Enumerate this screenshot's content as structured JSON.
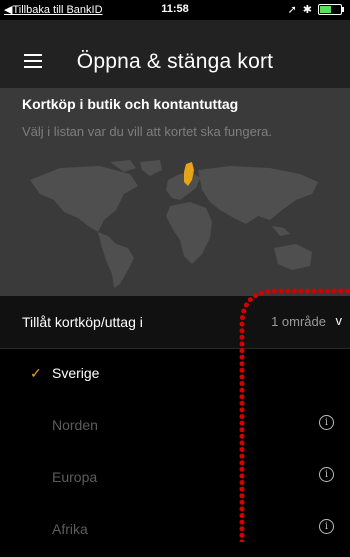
{
  "status_bar": {
    "back_label": "◀Tillbaka till BankID",
    "time": "11:58",
    "battery_color": "#5be05b"
  },
  "header": {
    "menu_icon": "hamburger-icon",
    "title": "Öppna & stänga kort"
  },
  "hero": {
    "heading": "Kortköp i butik och kontantuttag",
    "description": "Välj i listan var du vill att kortet ska fungera.",
    "highlight_color": "#e6a419"
  },
  "allow": {
    "label": "Tillåt kortköp/uttag i",
    "value": "1 område",
    "chevron": "v"
  },
  "regions": [
    {
      "name": "Sverige",
      "selected": true,
      "check": "✓"
    },
    {
      "name": "Norden",
      "selected": false,
      "info": "i"
    },
    {
      "name": "Europa",
      "selected": false,
      "info": "i"
    },
    {
      "name": "Afrika",
      "selected": false,
      "info": "i"
    }
  ],
  "annotation_color": "#d40000"
}
